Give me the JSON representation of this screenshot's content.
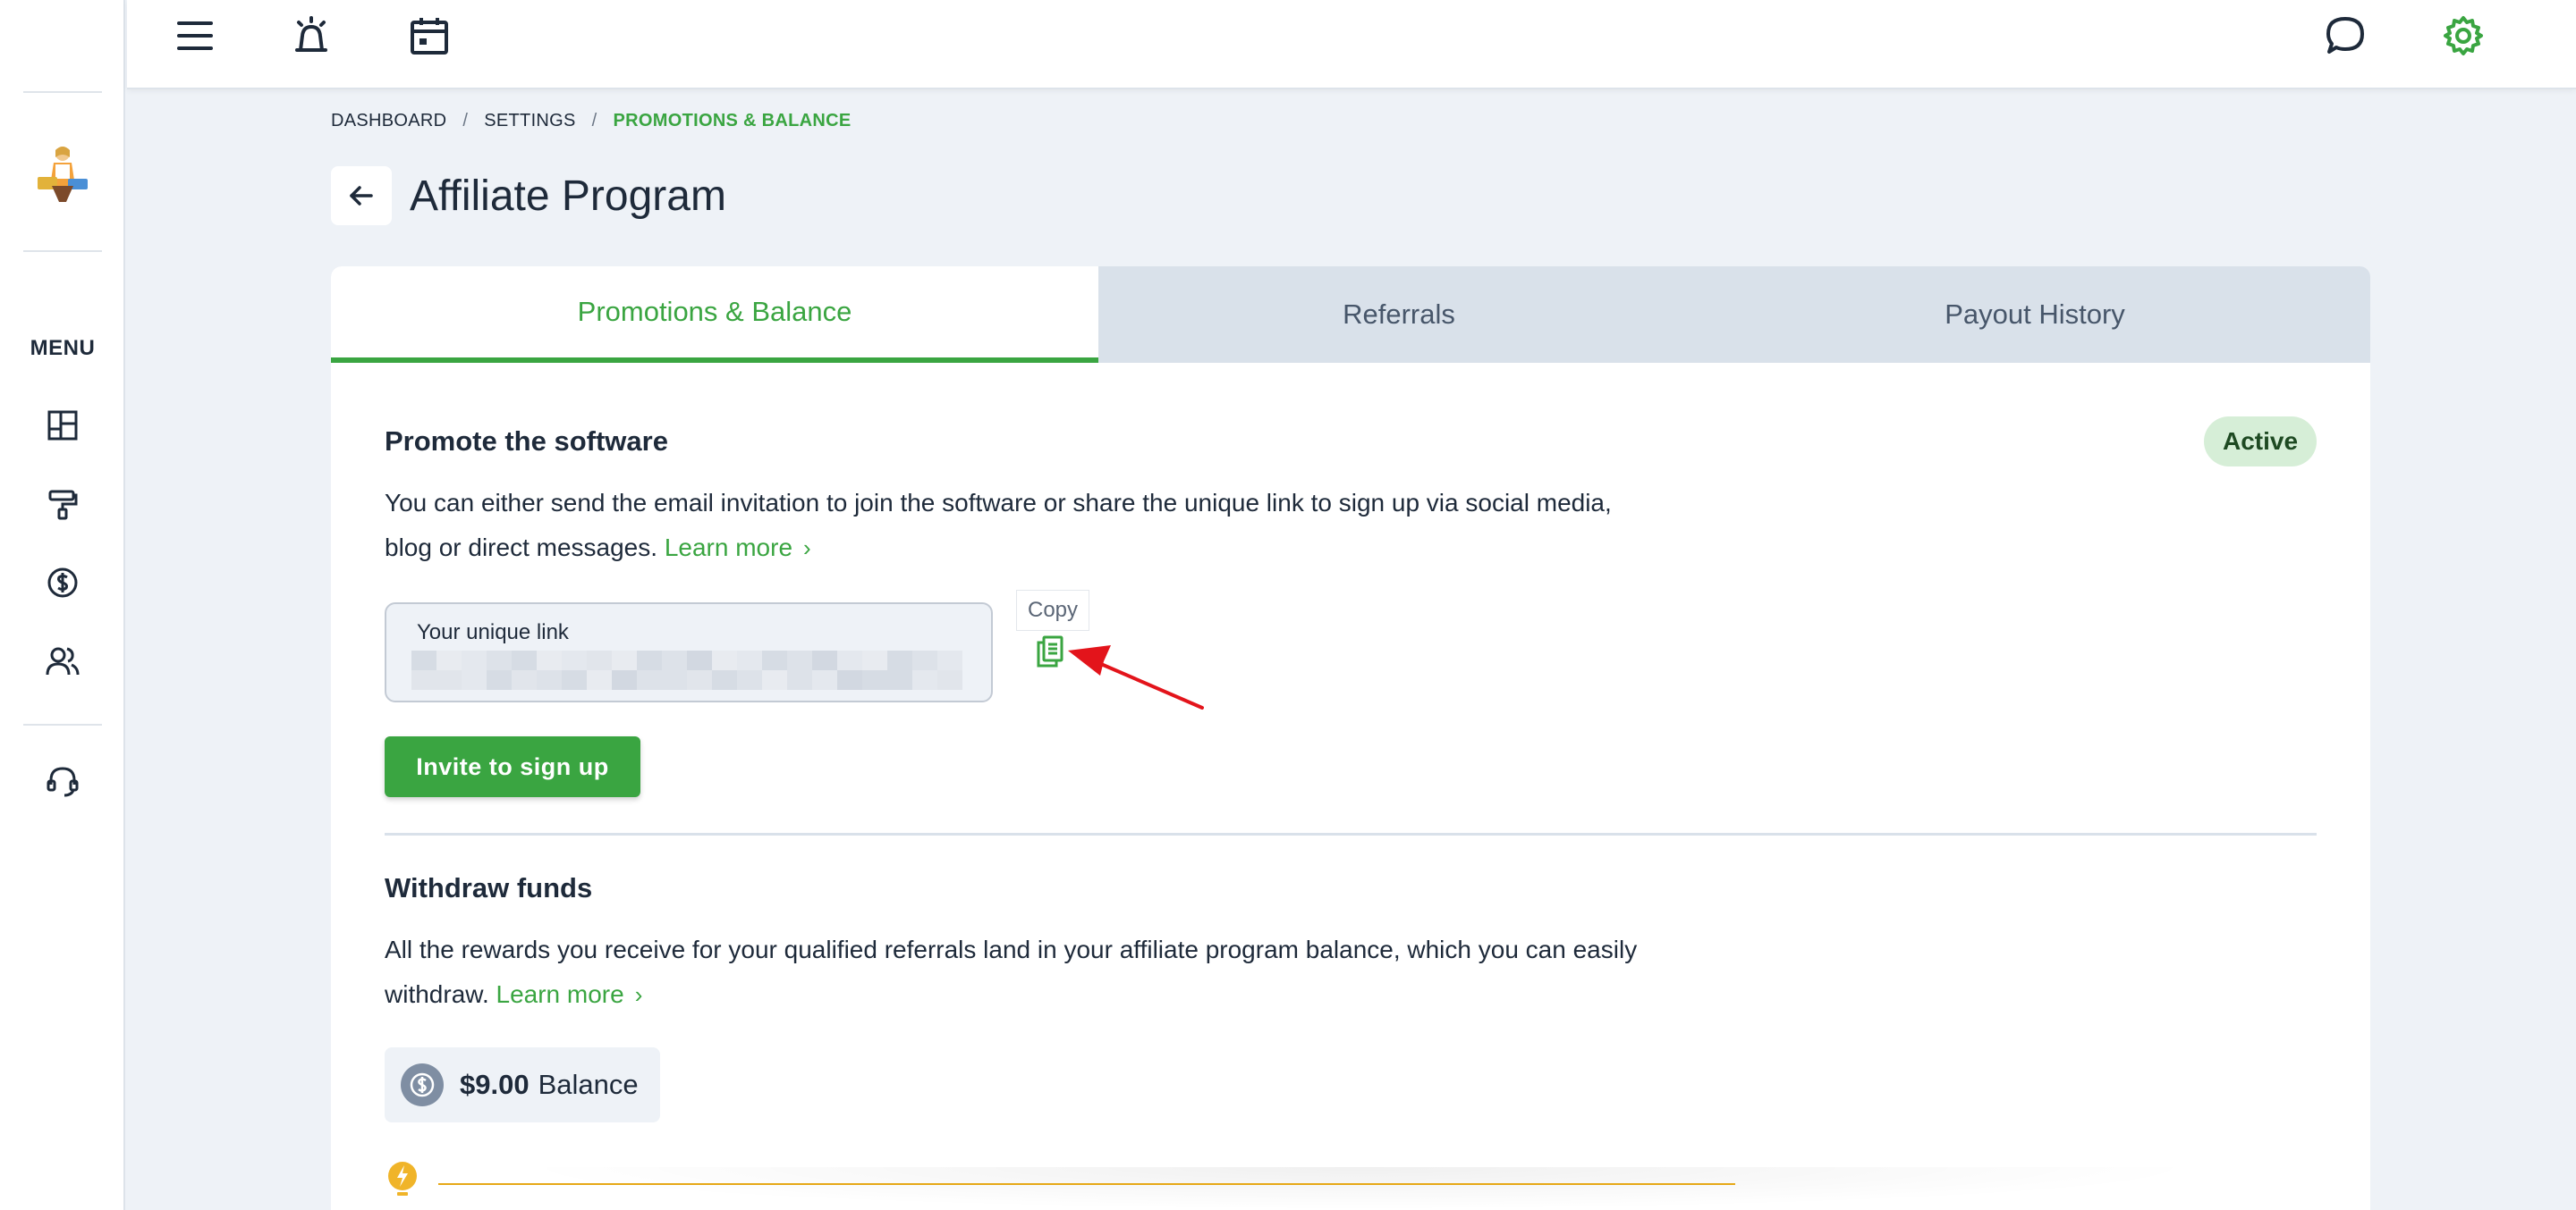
{
  "sidebar": {
    "menu_label": "MENU",
    "items": [
      {
        "name": "dashboard",
        "icon": "dashboard-grid-icon"
      },
      {
        "name": "paint-roller",
        "icon": "paint-roller-icon"
      },
      {
        "name": "billing",
        "icon": "dollar-circle-icon"
      },
      {
        "name": "users",
        "icon": "users-icon"
      },
      {
        "name": "support",
        "icon": "headset-icon"
      }
    ]
  },
  "topbar": {
    "icons": [
      "menu-icon",
      "alarm-icon",
      "calendar-icon",
      "chat-icon",
      "gear-icon"
    ]
  },
  "breadcrumb": {
    "items": [
      "DASHBOARD",
      "SETTINGS"
    ],
    "separator": "/",
    "current": "PROMOTIONS & BALANCE"
  },
  "page": {
    "title": "Affiliate Program"
  },
  "tabs": [
    {
      "label": "Promotions & Balance",
      "active": true
    },
    {
      "label": "Referrals",
      "active": false
    },
    {
      "label": "Payout History",
      "active": false
    }
  ],
  "promote": {
    "title": "Promote the software",
    "status": "Active",
    "description": "You can either send the email invitation to join the software or share the unique link to sign up via social media, blog or direct messages.",
    "learn_more": "Learn more",
    "link_label": "Your unique link",
    "copy_tooltip": "Copy",
    "invite_button": "Invite to sign up"
  },
  "withdraw": {
    "title": "Withdraw funds",
    "description": "All the rewards you receive for your qualified referrals land in your affiliate program balance, which you can easily withdraw.",
    "learn_more": "Learn more",
    "balance_amount": "$9.00",
    "balance_label": "Balance"
  },
  "colors": {
    "accent_green": "#3aa541",
    "badge_bg": "#d6eed7",
    "annotation_red": "#e3141b",
    "tip_yellow": "#e6a817"
  }
}
